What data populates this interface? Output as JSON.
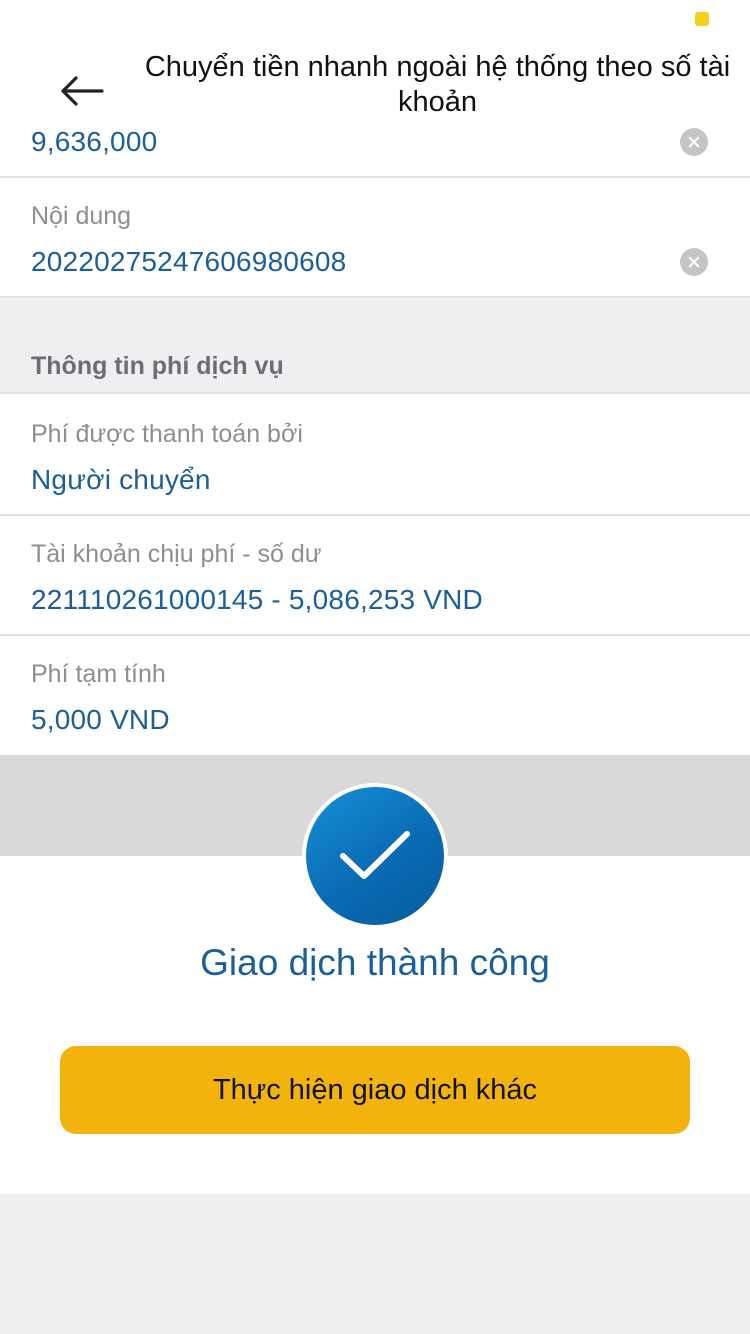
{
  "header": {
    "title": "Chuyển tiền nhanh ngoài hệ thống theo số tài khoản",
    "back_icon": "arrow-left-icon"
  },
  "form": {
    "amount": {
      "value": "9,636,000"
    },
    "content": {
      "label": "Nội dung",
      "value": "20220275247606980608"
    }
  },
  "fee_section": {
    "title": "Thông tin phí dịch vụ",
    "paid_by": {
      "label": "Phí được thanh toán bởi",
      "value": "Người chuyển"
    },
    "fee_account": {
      "label": "Tài khoản chịu phí - số dư",
      "value": "221110261000145 - 5,086,253 VND"
    },
    "estimated_fee": {
      "label": "Phí tạm tính",
      "value": "5,000 VND"
    }
  },
  "result": {
    "icon": "checkmark-icon",
    "message": "Giao dịch thành công",
    "button_label": "Thực hiện giao dịch khác"
  },
  "colors": {
    "accent_blue": "#1b5f9a",
    "button_yellow": "#f2b40c",
    "status_dot": "#f5cf1c"
  }
}
